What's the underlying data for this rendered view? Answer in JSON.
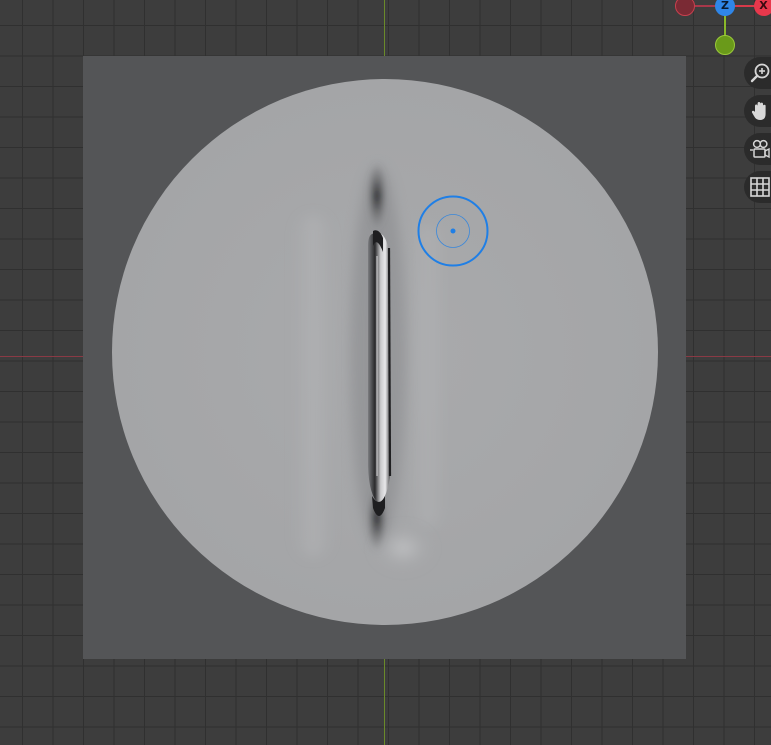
{
  "viewport": {
    "background_color": "#3d3d3d",
    "grid_color": "#303030",
    "x_axis_color": "#8a3a45",
    "y_axis_color": "#6a8a2a"
  },
  "gizmo": {
    "z_label": "Z",
    "x_label": "X",
    "z_color": "#2f86e8",
    "x_color": "#e8384c",
    "y_color": "#6a9a1a",
    "neg_x_color": "#7a2a34"
  },
  "navigation": {
    "buttons": [
      {
        "name": "zoom",
        "icon": "zoom-in-icon"
      },
      {
        "name": "pan",
        "icon": "hand-icon"
      },
      {
        "name": "camera",
        "icon": "camera-icon"
      },
      {
        "name": "grid",
        "icon": "grid-icon"
      }
    ]
  },
  "canvas": {
    "background_color": "#545557",
    "disc_color": "#a6a7a9",
    "brush_cursor_color": "#1f7fe6"
  }
}
